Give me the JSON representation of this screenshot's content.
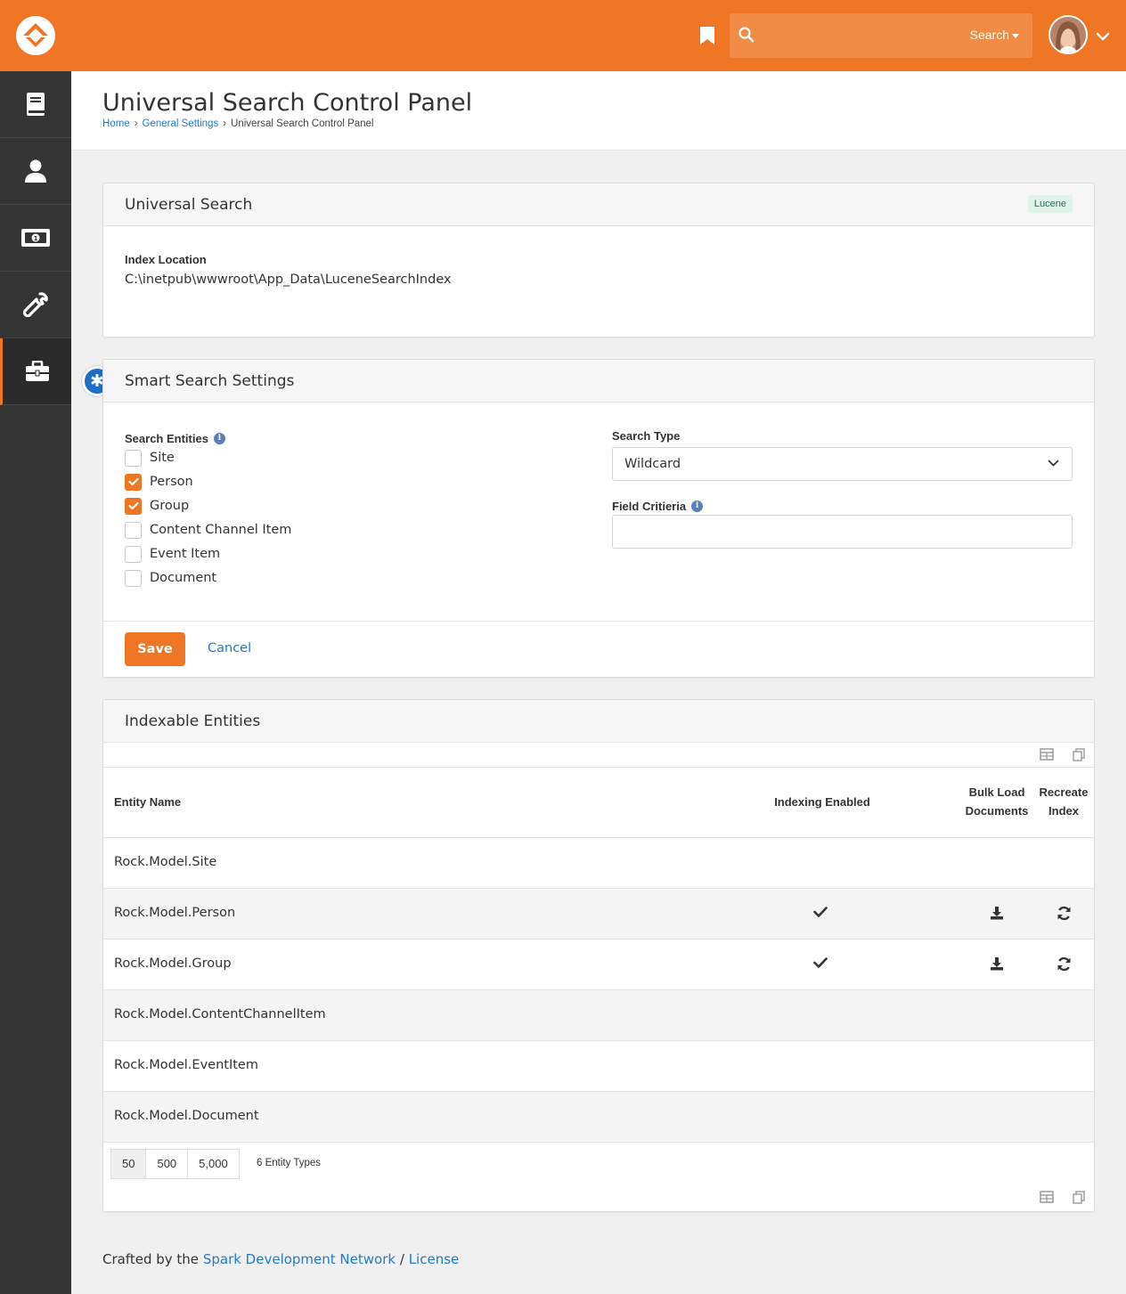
{
  "topbar": {
    "search_placeholder": "",
    "search_dropdown_label": "Search",
    "accent_color": "#ee7624"
  },
  "sidebar": {
    "items": [
      {
        "icon": "book-icon"
      },
      {
        "icon": "person-icon"
      },
      {
        "icon": "money-icon"
      },
      {
        "icon": "wrench-icon"
      },
      {
        "icon": "briefcase-icon",
        "active": true
      }
    ]
  },
  "page": {
    "title": "Universal Search Control Panel",
    "breadcrumbs": [
      "Home",
      "General Settings",
      "Universal Search Control Panel"
    ]
  },
  "universal_search": {
    "title": "Universal Search",
    "badge": "Lucene",
    "index_location_label": "Index Location",
    "index_location_value": "C:\\inetpub\\wwwroot\\App_Data\\LuceneSearchIndex"
  },
  "smart_search": {
    "title": "Smart Search Settings",
    "entities_label": "Search Entities",
    "entities": [
      {
        "label": "Site",
        "checked": false
      },
      {
        "label": "Person",
        "checked": true
      },
      {
        "label": "Group",
        "checked": true
      },
      {
        "label": "Content Channel Item",
        "checked": false
      },
      {
        "label": "Event Item",
        "checked": false
      },
      {
        "label": "Document",
        "checked": false
      }
    ],
    "search_type_label": "Search Type",
    "search_type_value": "Wildcard",
    "field_criteria_label": "Field Critieria",
    "field_criteria_value": "",
    "save_label": "Save",
    "cancel_label": "Cancel"
  },
  "indexable": {
    "title": "Indexable Entities",
    "columns": {
      "entity_name": "Entity Name",
      "indexing_enabled": "Indexing Enabled",
      "bulk_load_1": "Bulk Load",
      "bulk_load_2": "Documents",
      "recreate_1": "Recreate",
      "recreate_2": "Index"
    },
    "rows": [
      {
        "name": "Rock.Model.Site",
        "enabled": false
      },
      {
        "name": "Rock.Model.Person",
        "enabled": true
      },
      {
        "name": "Rock.Model.Group",
        "enabled": true
      },
      {
        "name": "Rock.Model.ContentChannelItem",
        "enabled": false
      },
      {
        "name": "Rock.Model.EventItem",
        "enabled": false
      },
      {
        "name": "Rock.Model.Document",
        "enabled": false
      }
    ],
    "page_sizes": [
      "50",
      "500",
      "5,000"
    ],
    "count_label": "6 Entity Types"
  },
  "footer": {
    "prefix": "Crafted by the",
    "link1": "Spark Development Network",
    "sep": "/",
    "link2": "License"
  }
}
